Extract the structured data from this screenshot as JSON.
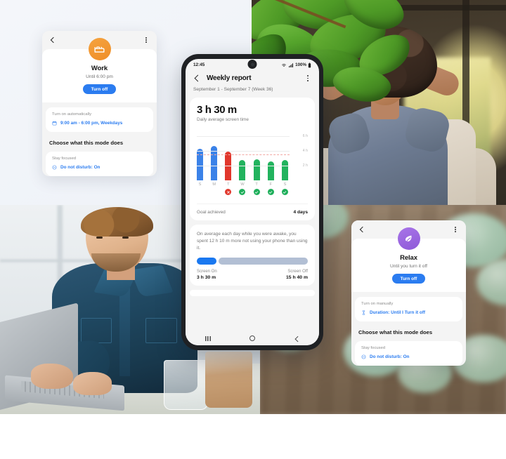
{
  "background": {
    "photos": [
      {
        "name": "relax-woman-photo",
        "alt": "Woman relaxing on a sofa with hands behind her head beside houseplants"
      },
      {
        "name": "focus-man-photo",
        "alt": "Man in a denim shirt working on a laptop at a desk"
      },
      {
        "name": "eucalyptus-photo",
        "alt": "Blurred eucalyptus leaves on a wooden surface"
      }
    ]
  },
  "work_card": {
    "back_icon": "back-chevron-icon",
    "menu_icon": "kebab-menu-icon",
    "avatar_icon": "bed-icon",
    "avatar_color": "#F09A30",
    "title": "Work",
    "subtitle": "Until 6:00 pm",
    "button_label": "Turn off",
    "button_color": "#2B7CF0",
    "schedule_label": "Turn on automatically",
    "schedule_icon": "calendar-icon",
    "schedule_value": "9:00 am - 6:00 pm, Weekdays",
    "section_heading": "Choose what this mode does",
    "options_label": "Stay focused",
    "option_icon": "do-not-disturb-icon",
    "option_value": "Do not disturb: On",
    "link_color": "#2B7CF0"
  },
  "relax_card": {
    "back_icon": "back-chevron-icon",
    "menu_icon": "kebab-menu-icon",
    "avatar_icon": "leaf-icon",
    "avatar_color": "#9B63E0",
    "title": "Relax",
    "subtitle": "Until you turn it off",
    "button_label": "Turn off",
    "button_color": "#2B7CF0",
    "schedule_label": "Turn on manually",
    "schedule_icon": "hourglass-icon",
    "schedule_value": "Duration: Until I Turn it off",
    "section_heading": "Choose what this mode does",
    "options_label": "Stay focused",
    "option_icon": "do-not-disturb-icon",
    "option_value": "Do not disturb: On",
    "link_color": "#2B7CF0"
  },
  "phone": {
    "status_bar": {
      "time": "12:45",
      "wifi_icon": "wifi-icon",
      "signal_icon": "cellular-signal-icon",
      "battery_percent": "100%",
      "battery_icon": "battery-full-icon"
    },
    "app_bar": {
      "back_icon": "back-chevron-icon",
      "title": "Weekly report",
      "menu_icon": "kebab-menu-icon"
    },
    "date_range": "September 1 - September 7 (Week 36)",
    "summary": {
      "value_hours": "3 h",
      "value_minutes": "30 m",
      "caption": "Daily average screen time"
    },
    "goal": {
      "label": "Goal achieved",
      "value": "4 days"
    },
    "insight": {
      "text": "On average each day while you were awake, you spent 12 h 10 m more not using your phone than using it.",
      "screen_on_label": "Screen On",
      "screen_on_value": "3 h 30 m",
      "screen_off_label": "Screen Off",
      "screen_off_value": "15 h 40 m",
      "on_color": "#1A78F0",
      "off_color": "#B2BFD4",
      "on_ratio": 18,
      "off_ratio": 82
    },
    "nav_bar": {
      "recents_icon": "recents-icon",
      "home_icon": "home-icon",
      "back_icon": "back-icon"
    }
  },
  "chart_data": {
    "type": "bar",
    "title": "Daily average screen time",
    "categories": [
      "S",
      "M",
      "T",
      "W",
      "T",
      "F",
      "S"
    ],
    "values": [
      4.3,
      4.6,
      3.9,
      2.7,
      2.8,
      2.6,
      2.75
    ],
    "bar_colors": [
      "#3B82E8",
      "#3B82E8",
      "#E1372C",
      "#22B35E",
      "#22B35E",
      "#22B35E",
      "#22B35E"
    ],
    "status": [
      "none",
      "none",
      "fail",
      "ok",
      "ok",
      "ok",
      "ok"
    ],
    "ylabel": "",
    "xlabel": "",
    "ylim": [
      0,
      7
    ],
    "yticks": [
      6,
      4,
      2
    ],
    "ytick_labels": [
      "6 h",
      "4 h",
      "2 h"
    ],
    "goal_line": 3.5,
    "goal_line_color": "#F2A9A4",
    "grid": true,
    "legend": "none"
  }
}
